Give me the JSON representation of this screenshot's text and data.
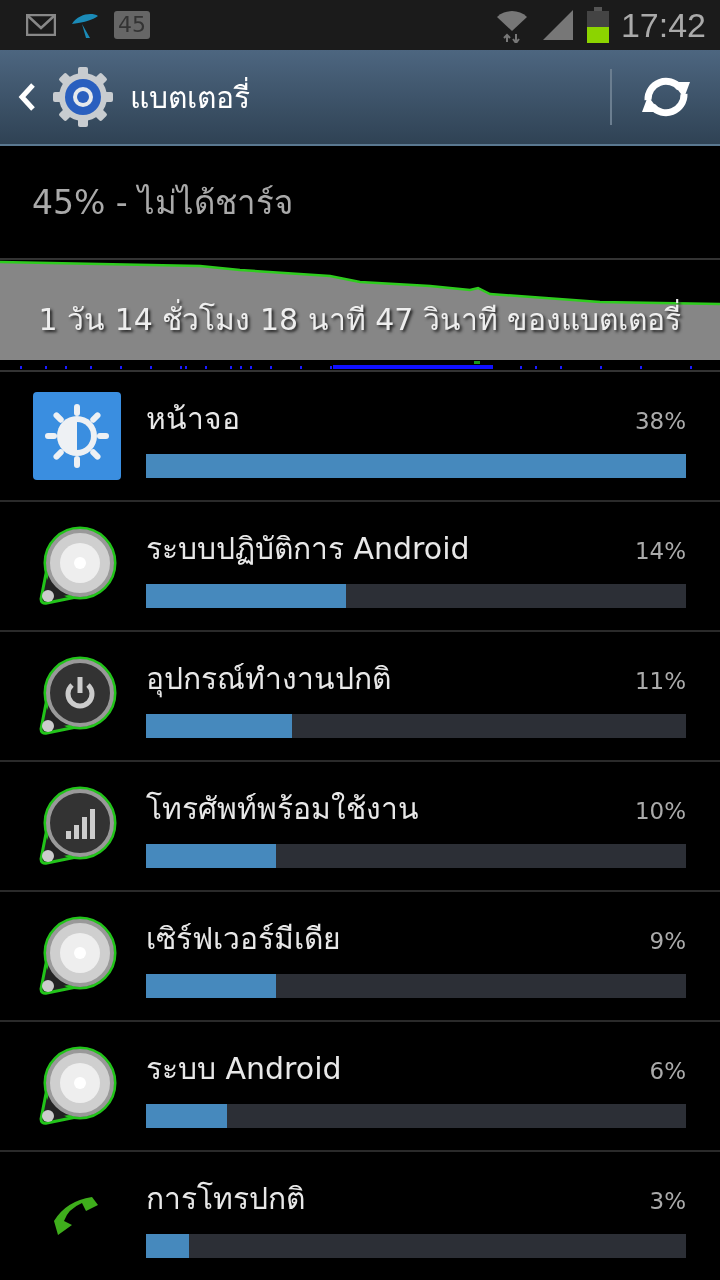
{
  "status_bar": {
    "battery_badge": "45",
    "time": "17:42"
  },
  "action_bar": {
    "title": "แบตเตอรี่"
  },
  "battery_status": "45% - ไม่ได้ชาร์จ",
  "graph": {
    "caption": "1 วัน 14 ชั่วโมง 18 นาที 47 วินาที ของแบตเตอรี่"
  },
  "usage": [
    {
      "kind": "display",
      "name": "หน้าจอ",
      "percent": "38%",
      "level": 1
    },
    {
      "kind": "metal",
      "name": "ระบบปฏิบัติการ Android",
      "percent": "14%",
      "level": 0.37
    },
    {
      "kind": "power",
      "name": "อุปกรณ์ทำงานปกติ",
      "percent": "11%",
      "level": 0.27
    },
    {
      "kind": "signal",
      "name": "โทรศัพท์พร้อมใช้งาน",
      "percent": "10%",
      "level": 0.24
    },
    {
      "kind": "metal",
      "name": "เซิร์ฟเวอร์มีเดีย",
      "percent": "9%",
      "level": 0.24
    },
    {
      "kind": "metal",
      "name": "ระบบ Android",
      "percent": "6%",
      "level": 0.15
    },
    {
      "kind": "phone",
      "name": "การโทรปกติ",
      "percent": "3%",
      "level": 0.08
    }
  ]
}
